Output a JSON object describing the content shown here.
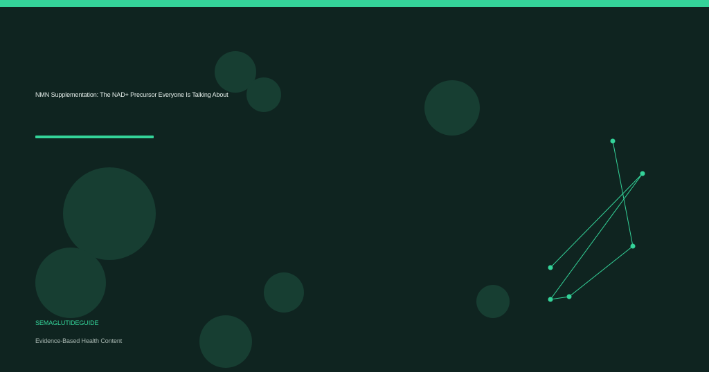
{
  "colors": {
    "background": "#0f2420",
    "accent": "#34d399",
    "bubble": "#173e32",
    "title_text": "#e6efeb",
    "muted_text": "#a9b8b2"
  },
  "header": {
    "title": "NMN Supplementation: The NAD+ Precursor Everyone Is Talking About"
  },
  "footer": {
    "brand": "SEMAGLUTIDEGUIDE",
    "tagline": "Evidence-Based Health Content"
  }
}
